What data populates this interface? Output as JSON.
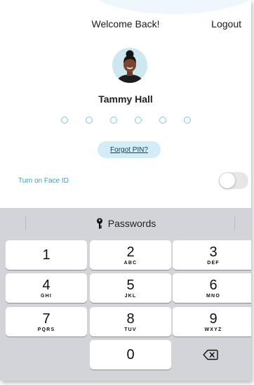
{
  "header": {
    "title": "Welcome Back!",
    "logout_label": "Logout"
  },
  "user": {
    "name": "Tammy Hall"
  },
  "pin": {
    "length": 6
  },
  "forgot_pin_label": "Forgot PIN?",
  "face_id": {
    "label": "Turn on Face ID",
    "enabled": false
  },
  "keyboard": {
    "bar_label": "Passwords",
    "keys": [
      {
        "digit": "1",
        "letters": ""
      },
      {
        "digit": "2",
        "letters": "ABC"
      },
      {
        "digit": "3",
        "letters": "DEF"
      },
      {
        "digit": "4",
        "letters": "GHI"
      },
      {
        "digit": "5",
        "letters": "JKL"
      },
      {
        "digit": "6",
        "letters": "MNO"
      },
      {
        "digit": "7",
        "letters": "PQRS"
      },
      {
        "digit": "8",
        "letters": "TUV"
      },
      {
        "digit": "9",
        "letters": "WXYZ"
      },
      {
        "digit": "0",
        "letters": ""
      }
    ]
  },
  "colors": {
    "accent": "#2aa4c8",
    "pin_dot_border": "#7ec6db",
    "forgot_pin_bg": "#d2edf7",
    "keyboard_bg": "#d2d4d9"
  },
  "icons": {
    "bar_icon": "key-icon",
    "delete_icon": "backspace-icon"
  }
}
